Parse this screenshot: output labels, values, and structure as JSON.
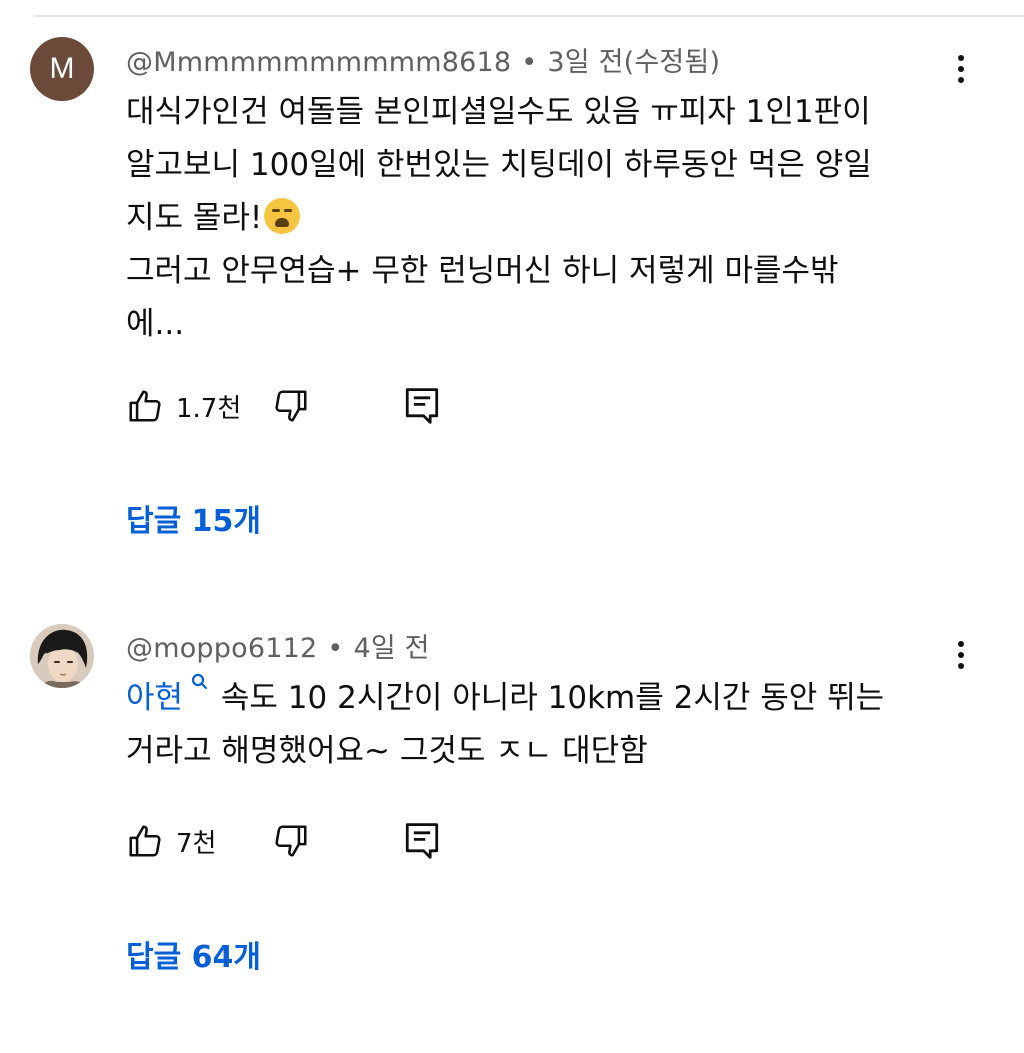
{
  "comments": [
    {
      "avatar_letter": "M",
      "avatar_color": "#6b4a3a",
      "username": "@Mmmmmmmmmmm8618",
      "separator": "•",
      "time": "3일 전(수정됨)",
      "lines": [
        "대식가인건 여돌들 본인피셜일수도 있음 ㅠ피자 1인1판이",
        "알고보니 100일에 한번있는 치팅데이 하루동안 먹은 양일",
        "지도 몰라!",
        "그러고 안무연습+ 무한 런닝머신 하니 저렇게 마를수밖",
        "에..."
      ],
      "emoji": "loudly-crying-face",
      "like_count": "1.7천",
      "replies_label": "답글 15개"
    },
    {
      "avatar_kind": "photo",
      "username": "@moppo6112",
      "separator": "•",
      "time": "4일 전",
      "mention": "아현",
      "mention_icon": "search-icon",
      "lines": [
        " 속도 10 2시간이 아니라 10km를 2시간 동안 뛰는",
        "거라고 해명했어요~ 그것도 ㅈㄴ 대단함"
      ],
      "like_count": "7천",
      "replies_label": "답글 64개"
    }
  ],
  "colors": {
    "link_blue": "#065fd4",
    "meta_gray": "#606060",
    "text": "#0f0f0f"
  }
}
